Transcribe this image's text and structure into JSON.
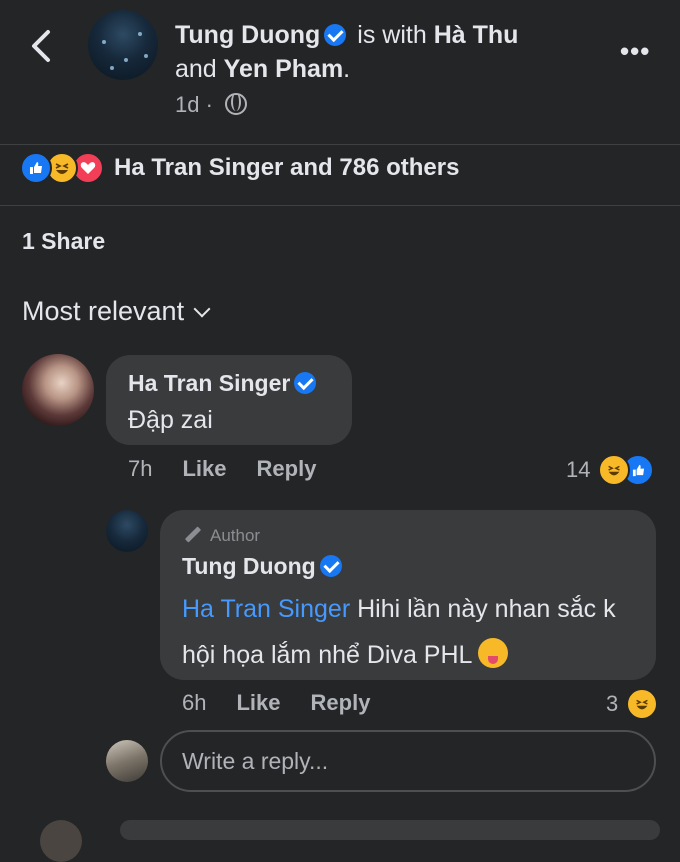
{
  "post_header": {
    "author": "Tung Duong",
    "with_text": "is with",
    "tagged_1": "Hà Thu",
    "and_text": "and",
    "tagged_2": "Yen Pham",
    "period": ".",
    "time": "1d",
    "separator": "·"
  },
  "reactions": {
    "summary": "Ha Tran Singer and 786 others",
    "icons": [
      "like-icon",
      "haha-icon",
      "love-icon"
    ]
  },
  "shares": "1 Share",
  "sort_label": "Most relevant",
  "comments": [
    {
      "name": "Ha Tran Singer",
      "text": "Đập zai",
      "time": "7h",
      "like_label": "Like",
      "reply_label": "Reply",
      "reaction_count": "14"
    }
  ],
  "reply": {
    "badge": "Author",
    "name": "Tung Duong",
    "mention": "Ha Tran Singer",
    "text": "Hihi lần này nhan sắc k hội họa lắm nhể Diva PHL",
    "time": "6h",
    "like_label": "Like",
    "reply_label": "Reply",
    "reaction_count": "3"
  },
  "composer": {
    "placeholder": "Write a reply..."
  },
  "colors": {
    "background": "#242526",
    "bubble": "#3a3b3c",
    "accent": "#1877f2",
    "mention": "#4599ff"
  }
}
